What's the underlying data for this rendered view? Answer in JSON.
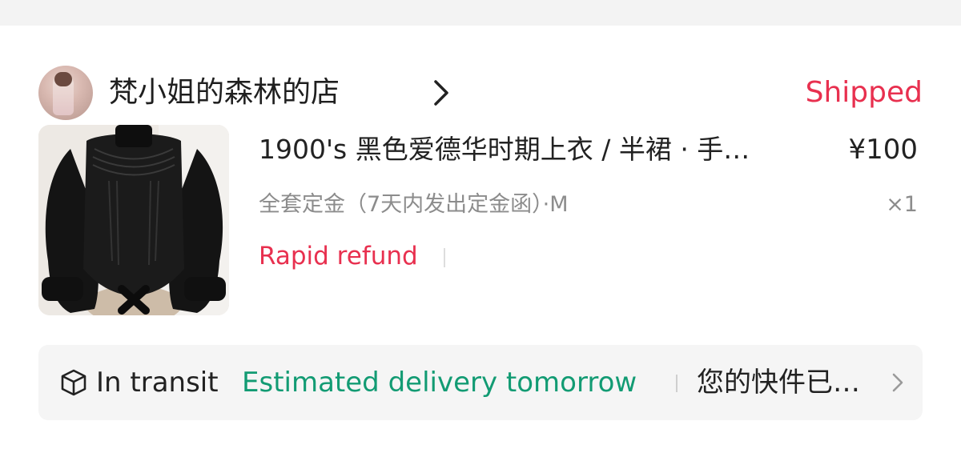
{
  "shop": {
    "name": "梵小姐的森林的店",
    "status": "Shipped"
  },
  "product": {
    "title": "1900's 黑色爱德华时期上衣 / 半裙 · 手…",
    "price": "¥100",
    "variant": "全套定金（7天内发出定金函）·M",
    "quantity": "×1",
    "refund_label": "Rapid refund"
  },
  "logistics": {
    "status": "In transit",
    "estimate": "Estimated delivery tomorrow",
    "message": "您的快件已…"
  },
  "colors": {
    "accent_red": "#e8304f",
    "accent_green": "#129b73",
    "muted_text": "#8c8c8c"
  },
  "icons": {
    "shop_chevron": "chevron-right-icon",
    "box": "package-box-icon",
    "logistics_chevron": "chevron-right-icon"
  }
}
